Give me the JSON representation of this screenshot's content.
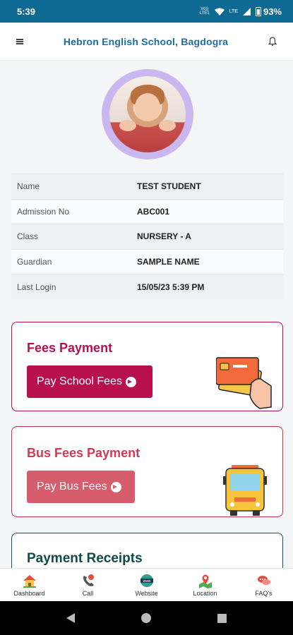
{
  "status_bar": {
    "time": "5:39",
    "volte": "Vo)) LTE1",
    "lte": "LTE",
    "battery": "93%"
  },
  "app_bar": {
    "title": "Hebron English School, Bagdogra",
    "menu_icon": "hamburger-icon",
    "notification_icon": "bell-icon"
  },
  "profile": {
    "avatar_icon": "student-photo",
    "rows": [
      {
        "label": "Name",
        "value": "TEST STUDENT"
      },
      {
        "label": "Admission No",
        "value": "ABC001"
      },
      {
        "label": "Class",
        "value": "NURSERY - A"
      },
      {
        "label": "Guardian",
        "value": "SAMPLE NAME"
      },
      {
        "label": "Last Login",
        "value": "15/05/23 5:39 PM"
      }
    ]
  },
  "cards": {
    "fees": {
      "title": "Fees Payment",
      "button": "Pay School Fees",
      "color": "#b8104f"
    },
    "bus": {
      "title": "Bus Fees Payment",
      "button": "Pay Bus Fees",
      "color": "#d23a55"
    },
    "receipts": {
      "title": "Payment Receipts",
      "color": "#0f4a4a"
    }
  },
  "bottom_nav": [
    {
      "label": "Dashboard",
      "icon": "house-icon"
    },
    {
      "label": "Call",
      "icon": "phone-icon"
    },
    {
      "label": "Website",
      "icon": "www-icon"
    },
    {
      "label": "Location",
      "icon": "map-pin-icon"
    },
    {
      "label": "FAQ's",
      "icon": "chat-bubble-icon"
    }
  ]
}
